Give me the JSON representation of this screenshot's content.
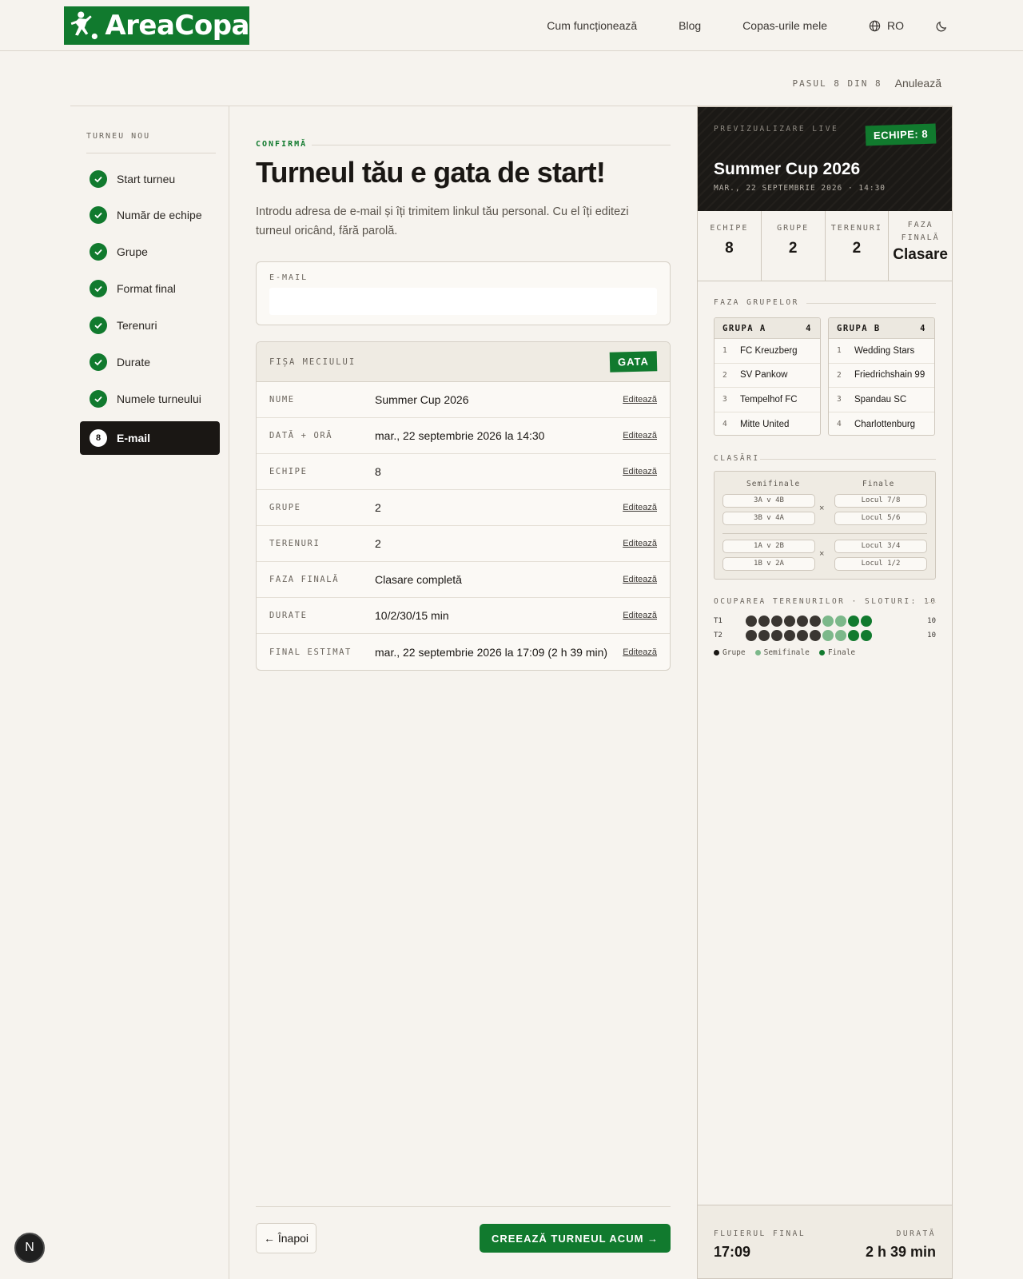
{
  "header": {
    "brand": "AreaCopa",
    "nav": [
      "Cum funcționează",
      "Blog",
      "Copas-urile mele"
    ],
    "lang": "RO"
  },
  "progress": {
    "step_text": "PASUL 8 DIN 8",
    "cancel": "Anulează"
  },
  "sidebar": {
    "title": "TURNEU NOU",
    "items": [
      {
        "label": "Start turneu",
        "done": true
      },
      {
        "label": "Număr de echipe",
        "done": true
      },
      {
        "label": "Grupe",
        "done": true
      },
      {
        "label": "Format final",
        "done": true
      },
      {
        "label": "Terenuri",
        "done": true
      },
      {
        "label": "Durate",
        "done": true
      },
      {
        "label": "Numele turneului",
        "done": true
      },
      {
        "label": "E-mail",
        "done": false,
        "number": "8"
      }
    ]
  },
  "main": {
    "kicker": "CONFIRMĂ",
    "title": "Turneul tău e gata de start!",
    "lead": "Introdu adresa de e-mail și îți trimitem linkul tău personal. Cu el îți editezi turneul oricând, fără parolă.",
    "email": {
      "label": "E-MAIL",
      "value": "",
      "placeholder": ""
    },
    "sheet": {
      "title": "FIȘA MECIULUI",
      "badge": "GATA",
      "edit_label": "Editează",
      "rows": [
        {
          "key": "NUME",
          "value": "Summer Cup 2026"
        },
        {
          "key": "DATĂ + ORĂ",
          "value": "mar., 22 septembrie 2026 la 14:30"
        },
        {
          "key": "ECHIPE",
          "value": "8"
        },
        {
          "key": "GRUPE",
          "value": "2"
        },
        {
          "key": "TERENURI",
          "value": "2"
        },
        {
          "key": "FAZA FINALĂ",
          "value": "Clasare completă"
        },
        {
          "key": "DURATE",
          "value": "10/2/30/15 min"
        },
        {
          "key": "FINAL ESTIMAT",
          "value": "mar., 22 septembrie 2026 la 17:09 (2 h 39 min)"
        }
      ]
    },
    "back_button": "← Înapoi",
    "create_button": "CREEAZĂ TURNEUL ACUM →"
  },
  "preview": {
    "live_label": "PREVIZUALIZARE LIVE",
    "teams_badge": "ECHIPE: 8",
    "name": "Summer Cup 2026",
    "date": "MAR., 22 SEPTEMBRIE 2026 · 14:30",
    "stats": [
      {
        "label": "ECHIPE",
        "value": "8"
      },
      {
        "label": "GRUPE",
        "value": "2"
      },
      {
        "label": "TERENURI",
        "value": "2"
      },
      {
        "label": "FAZA FINALĂ",
        "value": "Clasare"
      }
    ],
    "groups_title": "FAZA GRUPELOR",
    "groups": [
      {
        "name": "GRUPA A",
        "count": "4",
        "teams": [
          "FC Kreuzberg",
          "SV Pankow",
          "Tempelhof FC",
          "Mitte United"
        ]
      },
      {
        "name": "GRUPA B",
        "count": "4",
        "teams": [
          "Wedding Stars",
          "Friedrichshain 99",
          "Spandau SC",
          "Charlottenburg"
        ]
      }
    ],
    "placements_title": "CLASĂRI",
    "bracket": {
      "semis_label": "Semifinale",
      "finals_label": "Finale",
      "top_semis": [
        "3A v 4B",
        "3B v 4A"
      ],
      "top_finals": [
        "Locul 7/8",
        "Locul 5/6"
      ],
      "bottom_semis": [
        "1A v 2B",
        "1B v 2A"
      ],
      "bottom_finals": [
        "Locul 3/4",
        "Locul 1/2"
      ],
      "vs_mark": "×"
    },
    "occupancy_title": "OCUPAREA TERENURILOR · SLOTURI: 10",
    "courts": [
      {
        "label": "T1",
        "slots": [
          "g",
          "g",
          "g",
          "g",
          "g",
          "g",
          "s",
          "s",
          "f",
          "f"
        ],
        "count": "10"
      },
      {
        "label": "T2",
        "slots": [
          "g",
          "g",
          "g",
          "g",
          "g",
          "g",
          "s",
          "s",
          "f",
          "f"
        ],
        "count": "10"
      }
    ],
    "legend": [
      "Grupe",
      "Semifinale",
      "Finale"
    ],
    "colors": {
      "group": "#3a3632",
      "semi": "#7cb88a",
      "final": "#117a2e",
      "accent": "#117a2e"
    },
    "footer": {
      "whistle_label": "FLUIERUL FINAL",
      "whistle_value": "17:09",
      "duration_label": "DURATĂ",
      "duration_value": "2 h 39 min"
    }
  },
  "dev_badge": "N"
}
